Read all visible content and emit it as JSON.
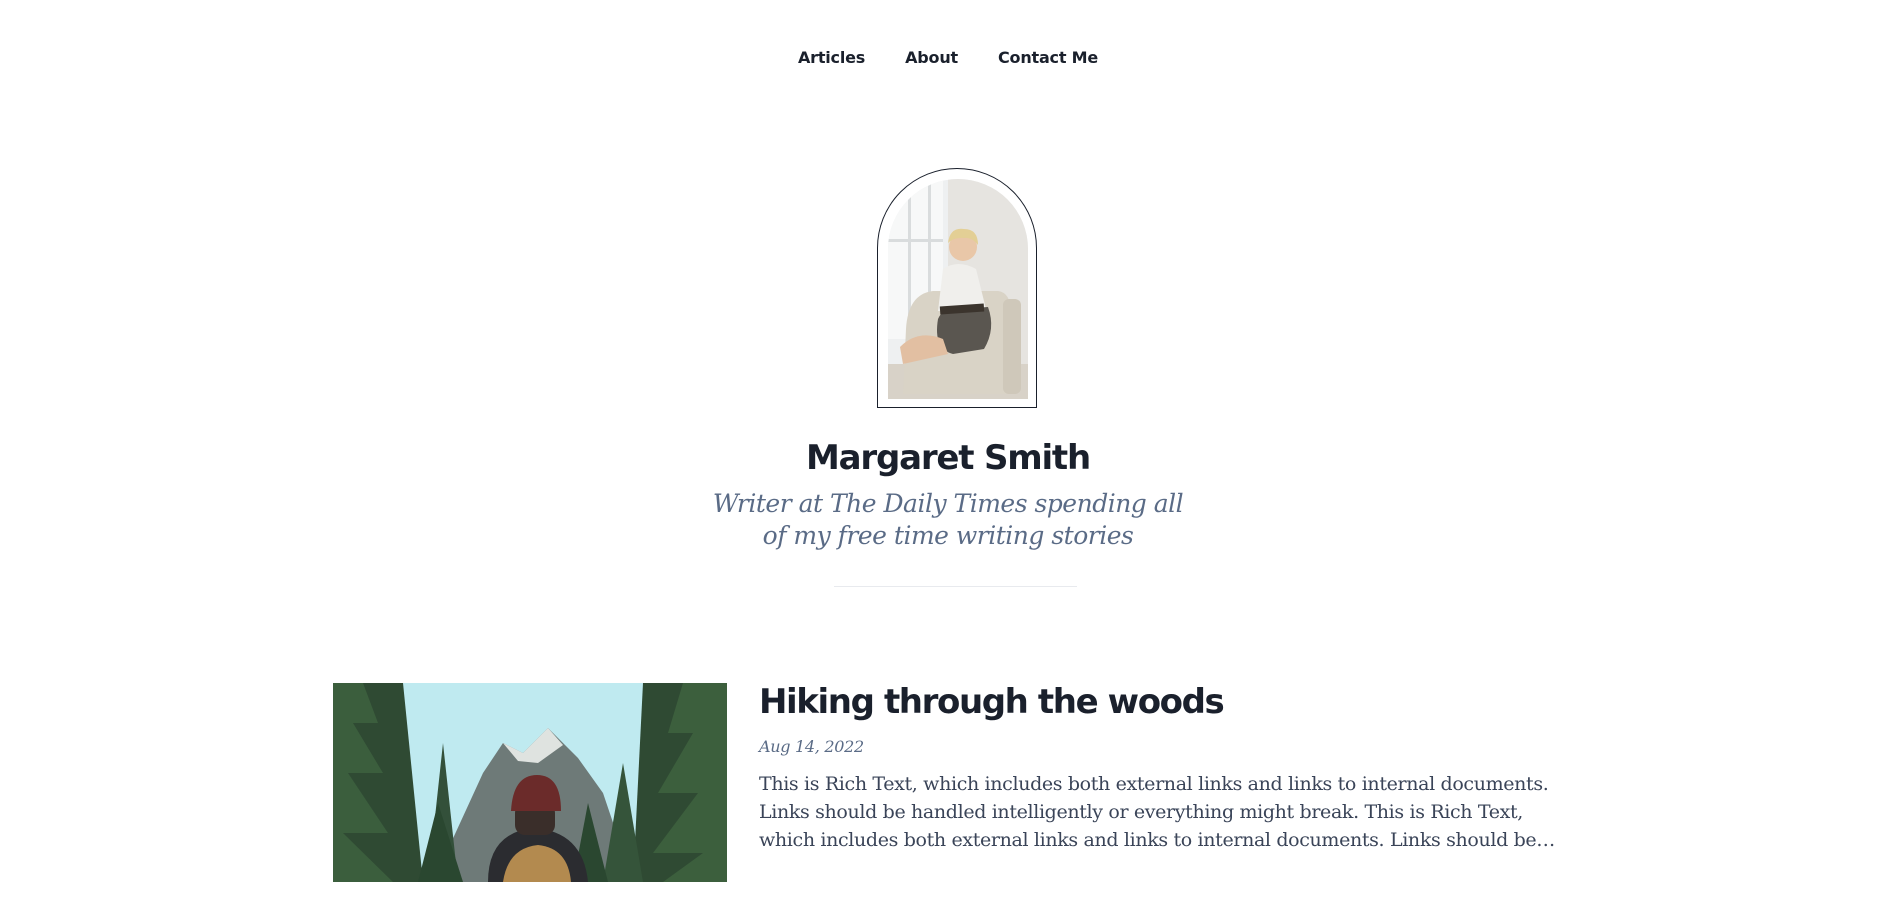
{
  "nav": {
    "items": [
      {
        "label": "Articles"
      },
      {
        "label": "About"
      },
      {
        "label": "Contact Me"
      }
    ]
  },
  "profile": {
    "name": "Margaret Smith",
    "tagline": "Writer at The Daily Times spending all of my free time writing stories"
  },
  "articles": [
    {
      "title": "Hiking through the woods",
      "date": "Aug 14, 2022",
      "excerpt": "This is Rich Text, which includes both external links and links to internal documents. Links should be handled intelligently or everything might break. This is Rich Text, which includes both external links and links to internal documents. Links should be handled intelligently or everything might break."
    }
  ]
}
